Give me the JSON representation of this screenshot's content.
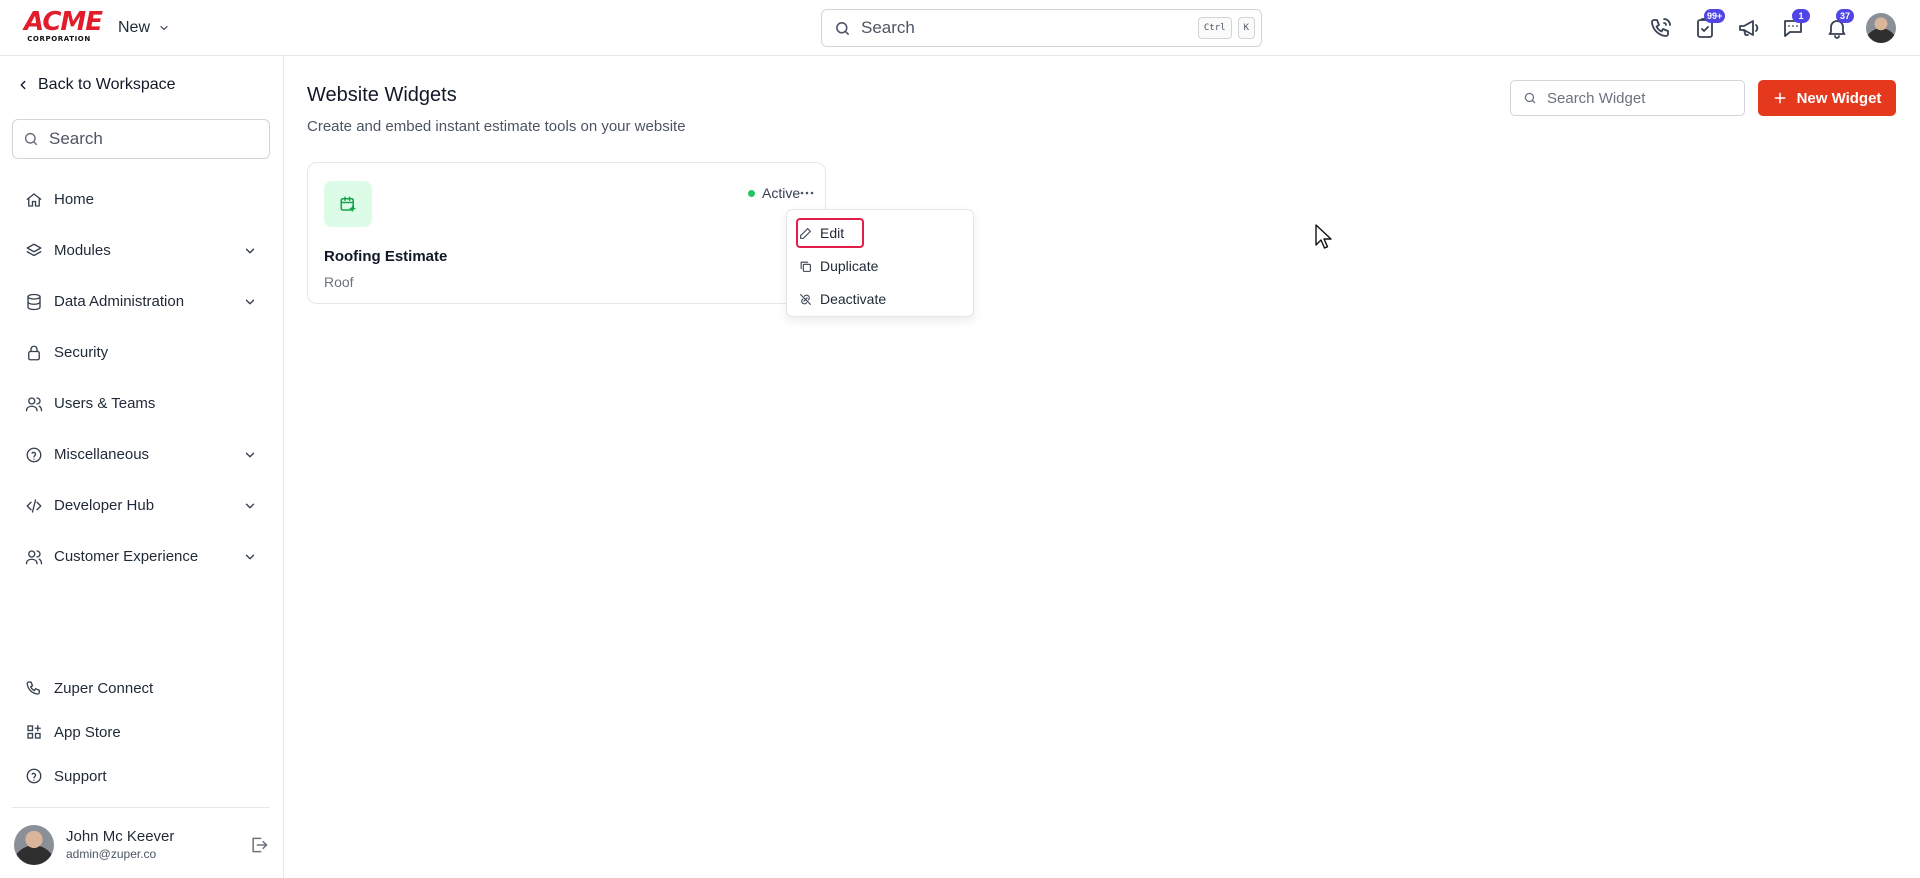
{
  "header": {
    "logo_text": "ACME",
    "logo_subtext": "CORPORATION",
    "new_menu_label": "New",
    "search_placeholder": "Search",
    "shortcut_keys": [
      "Ctrl",
      "K"
    ],
    "icons": [
      {
        "name": "phone-call-icon"
      },
      {
        "name": "task-check-icon",
        "badge": "99+"
      },
      {
        "name": "megaphone-icon"
      },
      {
        "name": "chat-icon",
        "badge": "1"
      },
      {
        "name": "bell-icon",
        "badge": "37"
      }
    ],
    "badge_color": "#4f46e5"
  },
  "sidebar": {
    "back_label": "Back to Workspace",
    "search_placeholder": "Search",
    "items": [
      {
        "label": "Home",
        "icon": "home-icon",
        "expandable": false
      },
      {
        "label": "Modules",
        "icon": "layers-icon",
        "expandable": true
      },
      {
        "label": "Data Administration",
        "icon": "database-icon",
        "expandable": true
      },
      {
        "label": "Security",
        "icon": "lock-icon",
        "expandable": false
      },
      {
        "label": "Users & Teams",
        "icon": "users-icon",
        "expandable": false
      },
      {
        "label": "Miscellaneous",
        "icon": "help-circle-icon",
        "expandable": true
      },
      {
        "label": "Developer Hub",
        "icon": "code-icon",
        "expandable": true
      },
      {
        "label": "Customer Experience",
        "icon": "customers-icon",
        "expandable": true
      }
    ],
    "bottom_items": [
      {
        "label": "Zuper Connect",
        "icon": "phone-icon"
      },
      {
        "label": "App Store",
        "icon": "app-grid-icon"
      },
      {
        "label": "Support",
        "icon": "help-circle-icon"
      }
    ],
    "user": {
      "name": "John Mc Keever",
      "email": "admin@zuper.co"
    }
  },
  "main": {
    "title": "Website Widgets",
    "subtitle": "Create and embed instant estimate tools on your website",
    "search_placeholder": "Search Widget",
    "new_button_label": "New Widget",
    "accent_color": "#e5391e",
    "widgets": [
      {
        "title": "Roofing Estimate",
        "category": "Roof",
        "status": "Active",
        "status_color": "#22c55e",
        "icon": "calendar-plus-icon"
      }
    ],
    "menu": {
      "items": [
        {
          "label": "Edit",
          "icon": "pencil-icon",
          "highlighted": true
        },
        {
          "label": "Duplicate",
          "icon": "copy-icon",
          "highlighted": false
        },
        {
          "label": "Deactivate",
          "icon": "link-off-icon",
          "highlighted": false
        }
      ]
    }
  }
}
